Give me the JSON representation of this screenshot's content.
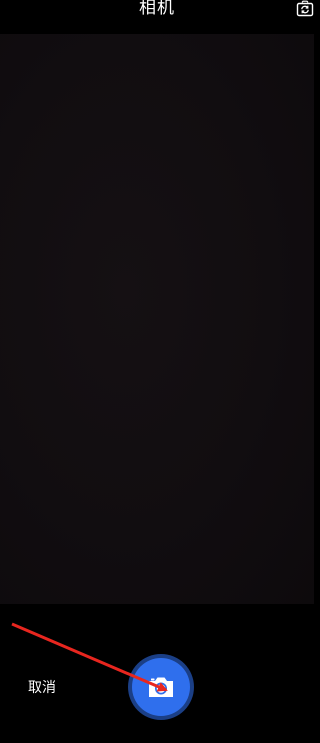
{
  "header": {
    "title": "相机",
    "switch_icon": "camera-switch-icon"
  },
  "controls": {
    "cancel_label": "取消",
    "shutter_icon": "camera-icon"
  },
  "colors": {
    "background": "#000000",
    "viewfinder": "#110d10",
    "shutter": "#2f6fed",
    "shutter_ring": "#1b3f86",
    "annotation_arrow": "#e8261f"
  }
}
